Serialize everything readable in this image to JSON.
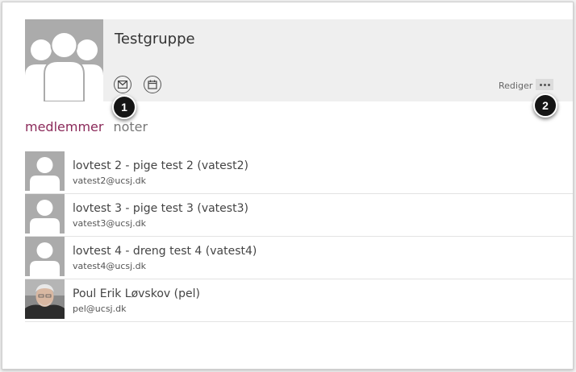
{
  "group": {
    "title": "Testgruppe",
    "edit_label": "Rediger",
    "actions": [
      {
        "icon": "mail-icon"
      },
      {
        "icon": "calendar-icon"
      }
    ]
  },
  "callouts": [
    "1",
    "2"
  ],
  "tabs": [
    {
      "label": "medlemmer",
      "active": true
    },
    {
      "label": "noter",
      "active": false
    }
  ],
  "members": [
    {
      "name": "lovtest 2 - pige test 2 (vatest2)",
      "email": "vatest2@ucsj.dk",
      "avatar": "placeholder"
    },
    {
      "name": "lovtest 3 - pige test 3 (vatest3)",
      "email": "vatest3@ucsj.dk",
      "avatar": "placeholder"
    },
    {
      "name": "lovtest 4 - dreng test 4 (vatest4)",
      "email": "vatest4@ucsj.dk",
      "avatar": "placeholder"
    },
    {
      "name": "Poul Erik Løvskov (pel)",
      "email": "pel@ucsj.dk",
      "avatar": "photo"
    }
  ],
  "colors": {
    "accent": "#8b2a5a",
    "header_bg": "#efefef",
    "avatar_placeholder": "#ababab"
  }
}
